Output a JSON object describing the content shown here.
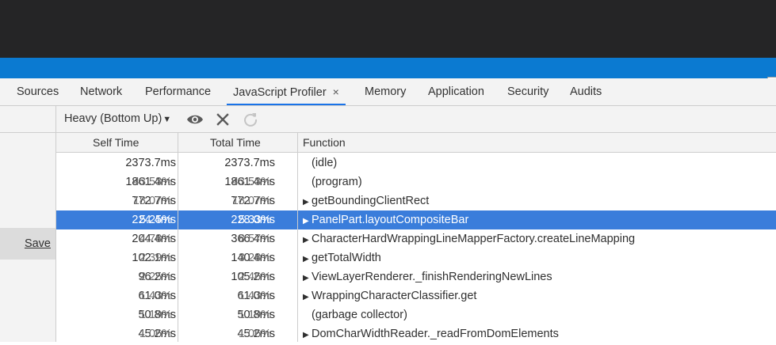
{
  "tabs": [
    {
      "label": "Sources"
    },
    {
      "label": "Network"
    },
    {
      "label": "Performance"
    },
    {
      "label": "JavaScript Profiler",
      "close": "×"
    },
    {
      "label": "Memory"
    },
    {
      "label": "Application"
    },
    {
      "label": "Security"
    },
    {
      "label": "Audits"
    }
  ],
  "sidebar": {
    "save_label": "Save"
  },
  "toolbar": {
    "view_mode": "Heavy (Bottom Up)",
    "caret": "▼",
    "focus_icon": "eye-icon",
    "exclude_icon": "close-icon",
    "restore_icon": "reload-icon"
  },
  "columns": {
    "self": "Self Time",
    "total": "Total Time",
    "function": "Function"
  },
  "rows": [
    {
      "self_ms": "2373.7ms",
      "self_pct": "",
      "total_ms": "2373.7ms",
      "total_pct": "",
      "expand": "",
      "name": "(idle)"
    },
    {
      "self_ms": "1861.4ms",
      "self_pct": "43.53%",
      "total_ms": "1861.4ms",
      "total_pct": "43.53%",
      "expand": "",
      "name": "(program)"
    },
    {
      "self_ms": "772.7ms",
      "self_pct": "18.07%",
      "total_ms": "772.7ms",
      "total_pct": "18.07%",
      "expand": "▶",
      "name": "getBoundingClientRect"
    },
    {
      "self_ms": "224.4ms",
      "self_pct": "5.25%",
      "total_ms": "228.0ms",
      "total_pct": "5.33%",
      "expand": "▶",
      "name": "PanelPart.layoutCompositeBar"
    },
    {
      "self_ms": "204.4ms",
      "self_pct": "4.78%",
      "total_ms": "366.4ms",
      "total_pct": "8.57%",
      "expand": "▶",
      "name": "CharacterHardWrappingLineMapperFactory.createLineMapping"
    },
    {
      "self_ms": "102.1ms",
      "self_pct": "2.39%",
      "total_ms": "140.4ms",
      "total_pct": "3.28%",
      "expand": "▶",
      "name": "getTotalWidth"
    },
    {
      "self_ms": "96.2ms",
      "self_pct": "2.25%",
      "total_ms": "105.2ms",
      "total_pct": "2.46%",
      "expand": "▶",
      "name": "ViewLayerRenderer._finishRenderingNewLines"
    },
    {
      "self_ms": "61.0ms",
      "self_pct": "1.43%",
      "total_ms": "61.0ms",
      "total_pct": "1.43%",
      "expand": "▶",
      "name": "WrappingCharacterClassifier.get"
    },
    {
      "self_ms": "50.8ms",
      "self_pct": "1.19%",
      "total_ms": "50.8ms",
      "total_pct": "1.19%",
      "expand": "",
      "name": "(garbage collector)"
    },
    {
      "self_ms": "45.2ms",
      "self_pct": "1.06%",
      "total_ms": "45.2ms",
      "total_pct": "1.06%",
      "expand": "▶",
      "name": "DomCharWidthReader._readFromDomElements"
    }
  ],
  "colors": {
    "selection": "#3a7ddb",
    "active_tab": "#1a73e8",
    "title_bar": "#252526",
    "status_bar": "#0b7ad1"
  }
}
